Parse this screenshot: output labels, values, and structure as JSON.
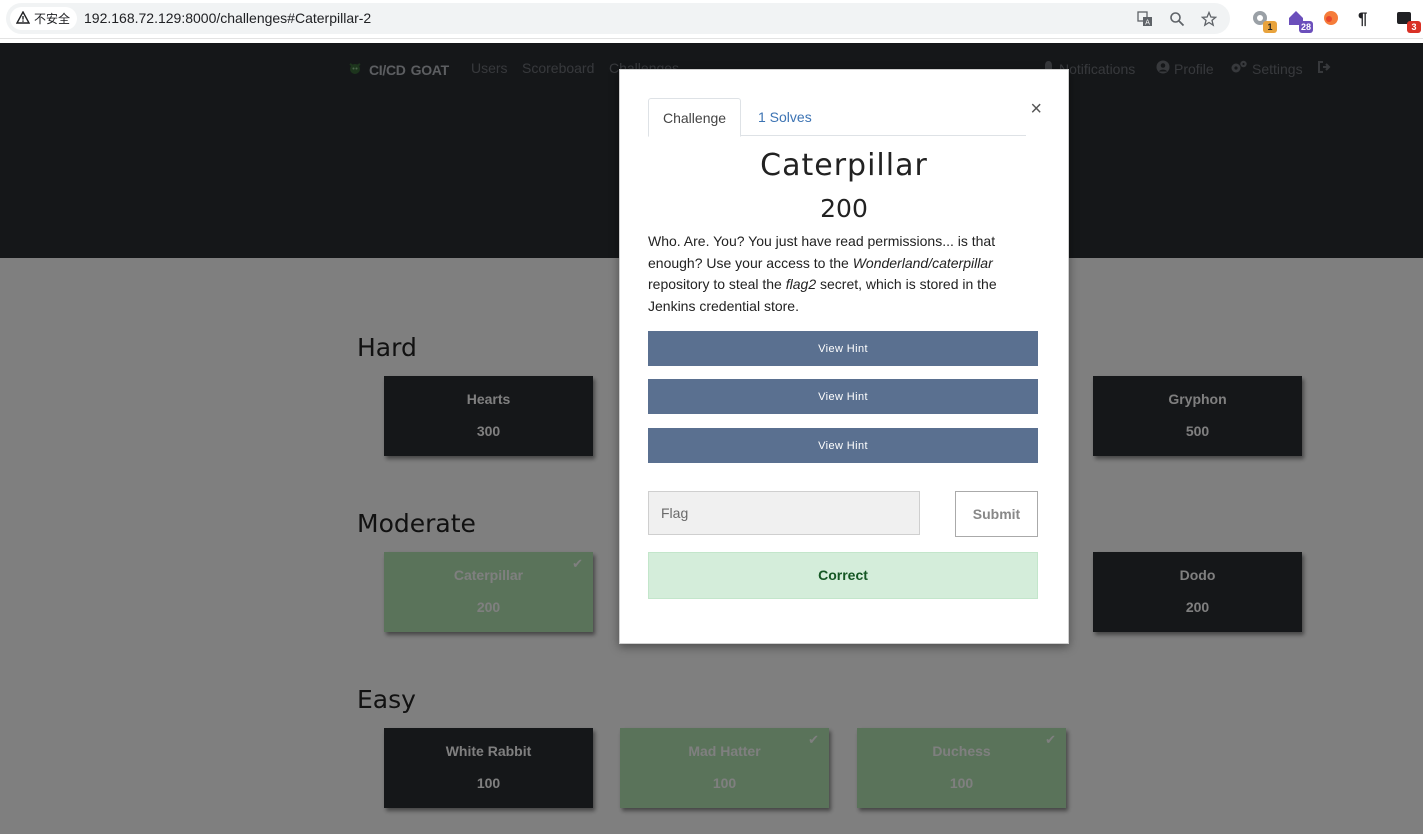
{
  "browser": {
    "security_label": "不安全",
    "url": "192.168.72.129:8000/challenges#Caterpillar-2",
    "extensions": [
      {
        "name": "ext-1",
        "badge": "1",
        "badge_color": "#e8a33d"
      },
      {
        "name": "ext-2",
        "badge": "28",
        "badge_color": "#6b4fbb"
      },
      {
        "name": "ext-3",
        "badge": "",
        "badge_color": ""
      },
      {
        "name": "ext-4",
        "badge": "",
        "badge_color": ""
      },
      {
        "name": "ext-5",
        "badge": "3",
        "badge_color": "#d93025"
      }
    ]
  },
  "navbar": {
    "brand_prefix": "CI/CD",
    "brand_suffix": "GOAT",
    "links": [
      "Users",
      "Scoreboard",
      "Challenges"
    ],
    "right": {
      "notifications": "Notifications",
      "profile": "Profile",
      "settings": "Settings"
    }
  },
  "categories": [
    {
      "title": "Hard",
      "challenges": [
        {
          "name": "Hearts",
          "points": "300",
          "solved": false
        },
        {
          "name": "Gryphon",
          "points": "500",
          "solved": false
        }
      ]
    },
    {
      "title": "Moderate",
      "challenges": [
        {
          "name": "Caterpillar",
          "points": "200",
          "solved": true
        },
        {
          "name": "Dodo",
          "points": "200",
          "solved": false
        }
      ]
    },
    {
      "title": "Easy",
      "challenges": [
        {
          "name": "White Rabbit",
          "points": "100",
          "solved": false
        },
        {
          "name": "Mad Hatter",
          "points": "100",
          "solved": true
        },
        {
          "name": "Duchess",
          "points": "100",
          "solved": true
        }
      ]
    }
  ],
  "modal": {
    "tabs": {
      "challenge": "Challenge",
      "solves": "1 Solves"
    },
    "name": "Caterpillar",
    "value": "200",
    "description": {
      "p1": "Who. Are. You? You just have read permissions... is that enough? Use your access to the ",
      "repo": "Wonderland/caterpillar",
      "p2": " repository to steal the ",
      "secret": "flag2",
      "p3": " secret, which is stored in the Jenkins credential store."
    },
    "hints": [
      "View Hint",
      "View Hint",
      "View Hint"
    ],
    "flag_placeholder": "Flag",
    "submit_label": "Submit",
    "result": "Correct",
    "close": "×"
  },
  "colors": {
    "header_bg": "#2b2e33",
    "unsolved_bg": "#2b2e33",
    "solved_bg": "#b4e7b4",
    "hint_btn": "#5a7090",
    "correct_bg": "#d4edda",
    "correct_text": "#155724"
  }
}
